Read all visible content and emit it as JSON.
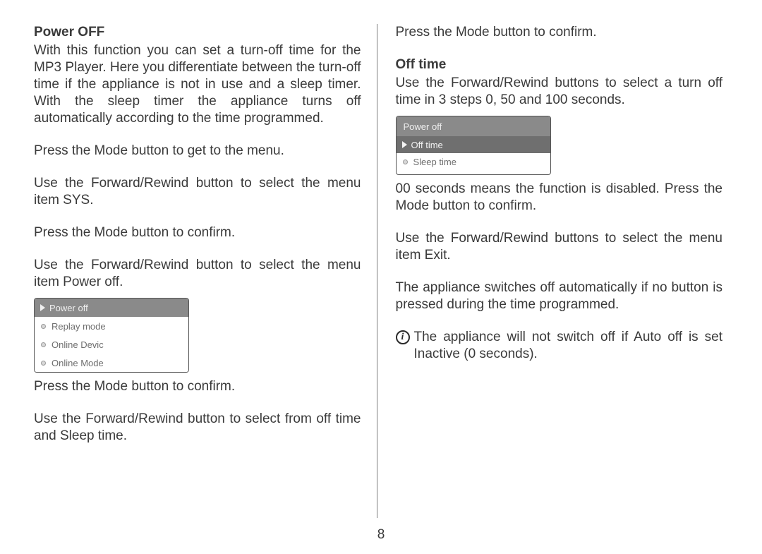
{
  "page_number": "8",
  "left": {
    "heading_power_off": "Power OFF",
    "p1": "With this function you can set a turn-off time for the MP3 Player. Here you differentiate between the turn-off time if the appliance is not in use and a sleep timer. With the sleep timer the appliance turns off automatically according to the time programmed.",
    "p2": "Press the Mode button to get to the menu.",
    "p3": "Use the Forward/Rewind button to select the menu item SYS.",
    "p4": "Press the Mode button to confirm.",
    "p5": "Use the Forward/Rewind button to select the menu item Power off.",
    "screen1": {
      "selected": "Power off",
      "items": [
        "Replay mode",
        "Online Devic",
        "Online Mode"
      ]
    },
    "p6": "Press the Mode button to confirm.",
    "p7": "Use the Forward/Rewind button to select from off time and Sleep time."
  },
  "right": {
    "p1": "Press the Mode button to confirm.",
    "heading_off_time": "Off time",
    "p2": "Use the Forward/Rewind buttons to select a turn off time in 3 steps 0, 50 and 100 seconds.",
    "screen2": {
      "header": "Power off",
      "selected": "Off time",
      "items": [
        "Sleep time"
      ]
    },
    "p3": "00 seconds means the function is disabled. Press the Mode button to confirm.",
    "p4": "Use the Forward/Rewind buttons to select the menu item Exit.",
    "p5": "The appliance switches off automatically if no button is pressed during the time programmed.",
    "info_glyph": "i",
    "p6": "The appliance will not switch off if Auto off is set Inactive (0 seconds)."
  }
}
